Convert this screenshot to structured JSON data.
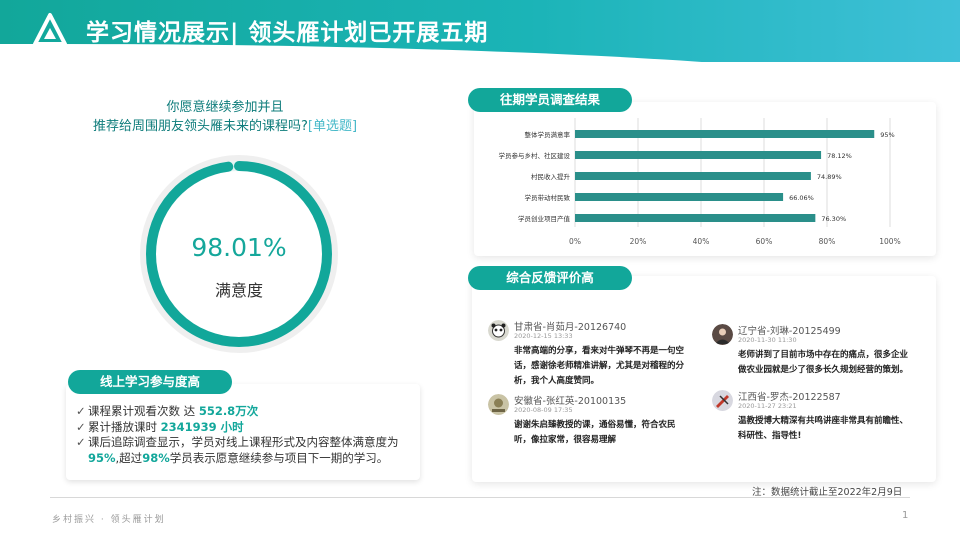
{
  "header": {
    "title": "学习情况展示| 领头雁计划已开展五期",
    "logo_icon": "triangle-logo-icon",
    "colors": {
      "accent": "#12a79a",
      "accent_light": "#3fc0d8"
    }
  },
  "question": {
    "line1": "你愿意继续参加并且",
    "line2": "推荐给周围朋友领头雁未来的课程吗?",
    "tag": "[单选题]"
  },
  "satisfaction": {
    "percent_text": "98.01%",
    "label": "满意度",
    "value": 0.9801
  },
  "online": {
    "title": "线上学习参与度高",
    "rows": [
      {
        "prefix": "课程累计观看次数  达 ",
        "highlight": "552.8万次",
        "suffix": ""
      },
      {
        "prefix": "累计播放课时  ",
        "highlight": "2341939 小时",
        "suffix": ""
      }
    ],
    "row3": {
      "p1": "课后追踪调查显示，学员对线上课程形式及内容整体满意度为",
      "h1": "95%",
      "p2": ",超过",
      "h2": "98%",
      "p3": "学员表示愿意继续参与项目下一期的学习。"
    }
  },
  "survey": {
    "title": "往期学员调查结果"
  },
  "chart_data": {
    "type": "bar",
    "orientation": "horizontal",
    "categories": [
      "整体学员满意率",
      "学员参与乡村、社区建设",
      "村民收入提升",
      "学员带动村民致",
      "学员创业项目产值"
    ],
    "values": [
      95,
      78.12,
      74.89,
      66.06,
      76.3
    ],
    "value_labels": [
      "95%",
      "78.12%",
      "74.89%",
      "66.06%",
      "76.30%"
    ],
    "xlim": [
      0,
      100
    ],
    "xticks": [
      "0%",
      "20%",
      "40%",
      "60%",
      "80%",
      "100%"
    ],
    "grid": true,
    "color": "#2a8f8a"
  },
  "feedback": {
    "title": "综合反馈评价高",
    "items": [
      {
        "name": "甘肃省-肖茹月-20126740",
        "date": "2020-12-15 13:33",
        "text": [
          "非常高端的分享，看来对牛弹琴不再是一句空",
          "话，感谢徐老师精准讲解，尤其是对稽程的分",
          "析，我个人高度赞同。"
        ],
        "avatar_icon": "panda-avatar-icon"
      },
      {
        "name": "辽宁省-刘琳-20125499",
        "date": "2020-11-30 11:30",
        "text": [
          "老师讲到了目前市场中存在的痛点，很多企业",
          "做农业园就是少了很多长久规划经营的策划。"
        ],
        "avatar_icon": "person-avatar-icon"
      },
      {
        "name": "安徽省-张红英-20100135",
        "date": "2020-08-09 17:35",
        "text": [
          "谢谢朱启臻教授的课，通俗易懂，符合农民",
          "听，像拉家常，很容易理解"
        ],
        "avatar_icon": "badge-avatar-icon"
      },
      {
        "name": "江西省-罗杰-20122587",
        "date": "2020-11-27 23:21",
        "text": [
          "温教授博大精深有共鸣讲座非常具有前瞻性、",
          "科研性、指导性!"
        ],
        "avatar_icon": "flag-avatar-icon"
      }
    ]
  },
  "note": "注：数据统计截止至2022年2月9日",
  "footer": {
    "text": "乡村振兴 · 领头雁计划",
    "page": "1"
  }
}
